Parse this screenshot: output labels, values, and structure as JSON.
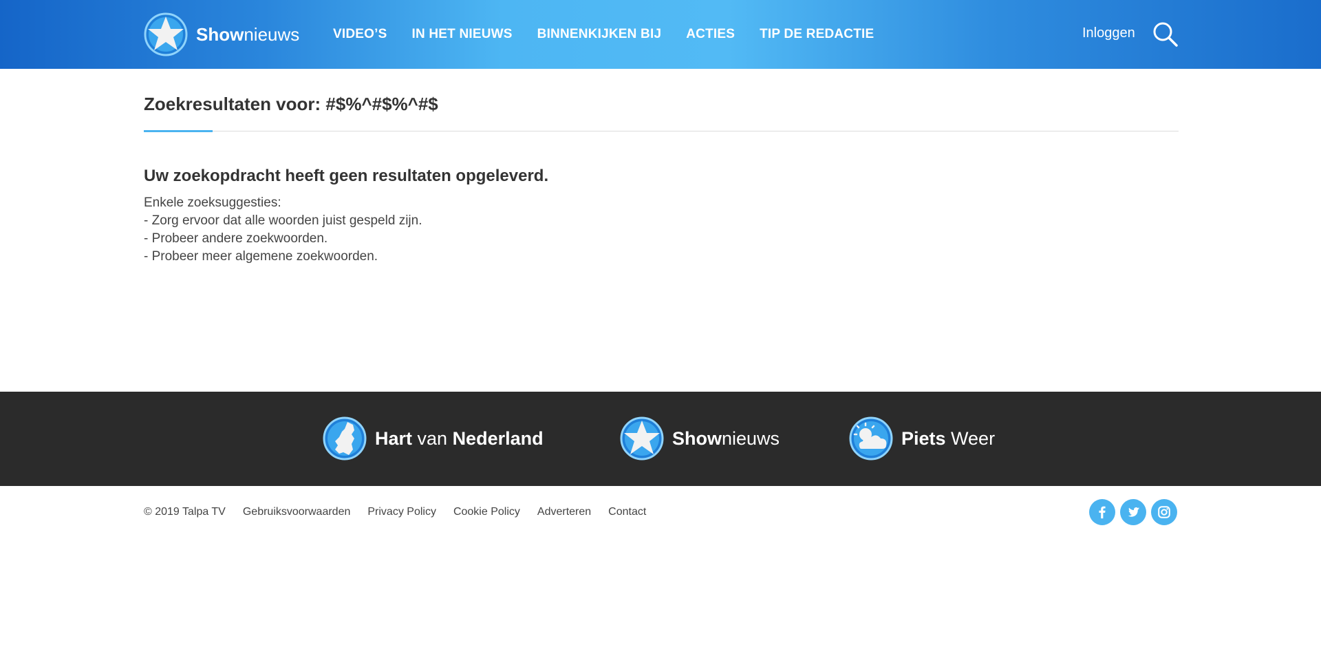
{
  "header": {
    "logo": {
      "bold": "Show",
      "regular": "nieuws"
    },
    "nav": [
      {
        "label": "VIDEO’S"
      },
      {
        "label": "IN HET NIEUWS"
      },
      {
        "label": "BINNENKIJKEN BIJ"
      },
      {
        "label": "ACTIES"
      },
      {
        "label": "TIP DE REDACTIE"
      }
    ],
    "login_label": "Inloggen",
    "search_icon": "search-icon"
  },
  "main": {
    "results_prefix": "Zoekresultaten voor: ",
    "query": "#$%^#$%^#$",
    "no_results_title": "Uw zoekopdracht heeft geen resultaten opgeleverd.",
    "suggestions_intro": "Enkele zoeksuggesties:",
    "suggestions": [
      "- Zorg ervoor dat alle woorden juist gespeld zijn.",
      "- Probeer andere zoekwoorden.",
      "- Probeer meer algemene zoekwoorden."
    ]
  },
  "footer": {
    "brands": [
      {
        "bold": "Hart",
        "middle": " van ",
        "bold2": "Nederland",
        "icon": "netherlands-map-icon"
      },
      {
        "bold": "Show",
        "regular": "nieuws",
        "icon": "star-icon"
      },
      {
        "bold": "Piets",
        "regular": " Weer",
        "icon": "sun-cloud-icon"
      }
    ],
    "copyright": "© 2019 Talpa TV",
    "links": [
      "Gebruiksvoorwaarden",
      "Privacy Policy",
      "Cookie Policy",
      "Adverteren",
      "Contact"
    ],
    "social": [
      "facebook-icon",
      "twitter-icon",
      "instagram-icon"
    ]
  },
  "colors": {
    "accent": "#4ab3f0",
    "header_dark": "#1565c8",
    "footer_bg": "#2b2b2b"
  }
}
